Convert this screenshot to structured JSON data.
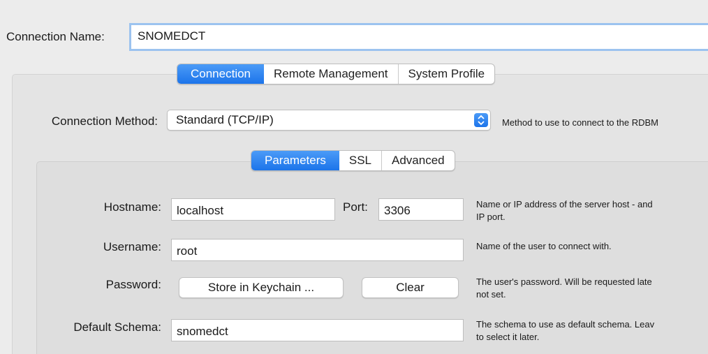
{
  "connection_name": {
    "label": "Connection Name:",
    "value": "SNOMEDCT"
  },
  "main_tabs": [
    {
      "label": "Connection",
      "active": true
    },
    {
      "label": "Remote Management",
      "active": false
    },
    {
      "label": "System Profile",
      "active": false
    }
  ],
  "method": {
    "label": "Connection Method:",
    "value": "Standard (TCP/IP)",
    "help": "Method to use to connect to the RDBM"
  },
  "param_tabs": [
    {
      "label": "Parameters",
      "active": true
    },
    {
      "label": "SSL",
      "active": false
    },
    {
      "label": "Advanced",
      "active": false
    }
  ],
  "hostname": {
    "label": "Hostname:",
    "value": "localhost",
    "help": "Name or IP address of the server host - and\nIP port."
  },
  "port": {
    "label": "Port:",
    "value": "3306"
  },
  "username": {
    "label": "Username:",
    "value": "root",
    "help": "Name of the user to connect with."
  },
  "password": {
    "label": "Password:",
    "store_button": "Store in Keychain ...",
    "clear_button": "Clear",
    "help": "The user's password. Will be requested late\nnot set."
  },
  "schema": {
    "label": "Default Schema:",
    "value": "snomedct",
    "help": "The schema to use as default schema. Leav\nto select it later."
  },
  "colors": {
    "accent": "#1c74ea",
    "focus_ring": "#9cc3ef"
  }
}
